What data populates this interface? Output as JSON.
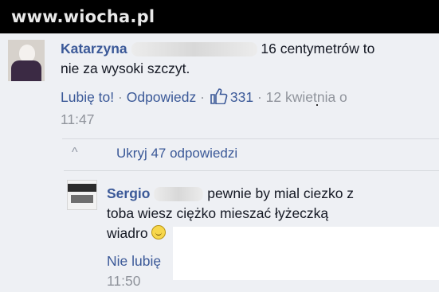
{
  "watermark": "www.wiocha.pl",
  "comment1": {
    "author": "Katarzyna",
    "text_line1": "16 centymetrów to",
    "text_line2": "nie za wysoki szczyt.",
    "like_label": "Lubię to!",
    "reply_label": "Odpowiedz",
    "like_count": "331",
    "timestamp_date": "12 kwietnia o",
    "timestamp_time": "11:47",
    "separator": "·"
  },
  "replies_toggle": {
    "chevron": "^",
    "label": "Ukryj 47 odpowiedzi"
  },
  "comment2": {
    "author": "Sergio",
    "text_line1": "pewnie by mial ciezko z",
    "text_line2": "toba wiesz ciężko mieszać łyżeczką",
    "text_line3": "wiadro",
    "like_label": "Nie lubię",
    "timestamp": "11:50",
    "emoji": "smiley-icon"
  },
  "colors": {
    "link": "#3b5998",
    "meta": "#90949c",
    "background": "#eef0f4",
    "topbar": "#000000"
  }
}
